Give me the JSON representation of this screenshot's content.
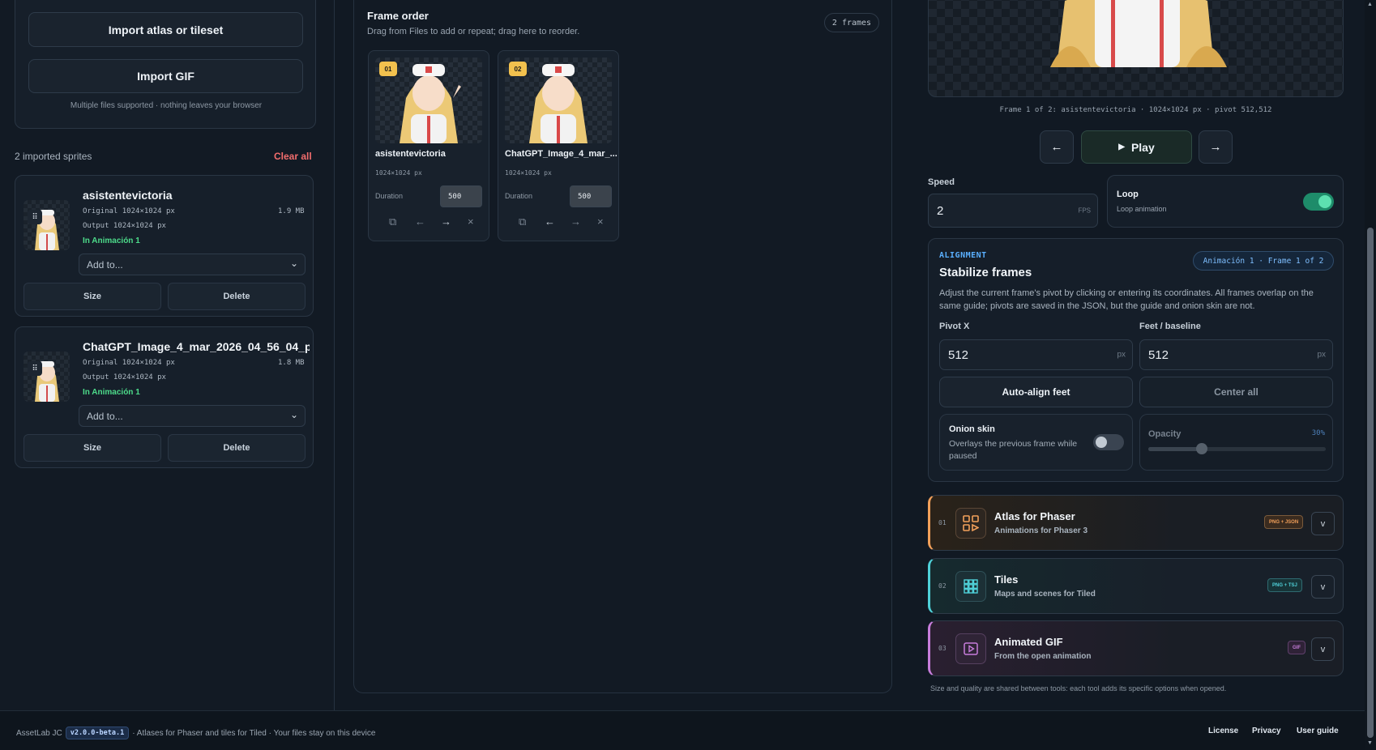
{
  "import": {
    "atlas_label": "Import atlas or tileset",
    "gif_label": "Import GIF",
    "hint": "Multiple files supported · nothing leaves your browser"
  },
  "sprites": {
    "count_label": "2 imported sprites",
    "clear_label": "Clear all",
    "items": [
      {
        "name": "asistentevictoria",
        "original": "Original 1024×1024 px",
        "output": "Output 1024×1024 px",
        "size": "1.9 MB",
        "status": "In Animación 1",
        "select": "Add to...",
        "size_btn": "Size",
        "delete_btn": "Delete"
      },
      {
        "name": "ChatGPT_Image_4_mar_2026_04_56_04_p",
        "original": "Original 1024×1024 px",
        "output": "Output 1024×1024 px",
        "size": "1.8 MB",
        "status": "In Animación 1",
        "select": "Add to...",
        "size_btn": "Size",
        "delete_btn": "Delete"
      }
    ]
  },
  "frames": {
    "title": "Frame order",
    "subtitle": "Drag from Files to add or repeat; drag here to reorder.",
    "count": "2 frames",
    "items": [
      {
        "badge": "01",
        "name": "asistentevictoria",
        "dims": "1024×1024 px",
        "duration_label": "Duration",
        "duration": "500"
      },
      {
        "badge": "02",
        "name": "ChatGPT_Image_4_mar_...",
        "dims": "1024×1024 px",
        "duration_label": "Duration",
        "duration": "500"
      }
    ]
  },
  "preview": {
    "caption": "Frame 1 of 2: asistentevictoria · 1024×1024 px · pivot 512,512",
    "prev": "←",
    "play": "Play",
    "next": "→"
  },
  "speed": {
    "label": "Speed",
    "value": "2",
    "unit": "FPS"
  },
  "loop": {
    "label": "Loop",
    "sub": "Loop animation",
    "on": true
  },
  "alignment": {
    "eyebrow": "ALIGNMENT",
    "title": "Stabilize frames",
    "chip": "Animación 1 · Frame 1 of 2",
    "desc": "Adjust the current frame's pivot by clicking or entering its coordinates. All frames overlap on the same guide; pivots are saved in the JSON, but the guide and onion skin are not.",
    "pivot_x_label": "Pivot X",
    "pivot_x": "512",
    "feet_label": "Feet / baseline",
    "feet": "512",
    "unit": "px",
    "auto_label": "Auto-align feet",
    "center_label": "Center all",
    "onion_title": "Onion skin",
    "onion_desc": "Overlays the previous frame while paused",
    "onion_on": false,
    "opacity_label": "Opacity",
    "opacity_value": "30%",
    "opacity_fraction": 0.3
  },
  "tools": [
    {
      "num": "01",
      "title": "Atlas for Phaser",
      "sub": "Animations for Phaser 3",
      "tag": "PNG + JSON",
      "color": "#f2a05a",
      "icon": "atlas-icon"
    },
    {
      "num": "02",
      "title": "Tiles",
      "sub": "Maps and scenes for Tiled",
      "tag": "PNG + TSJ",
      "color": "#4fd1d9",
      "icon": "tiles-grid-icon"
    },
    {
      "num": "03",
      "title": "Animated GIF",
      "sub": "From the open animation",
      "tag": "GIF",
      "color": "#c77ddb",
      "icon": "play-gif-icon"
    }
  ],
  "tools_note": "Size and quality are shared between tools: each tool adds its specific options when opened.",
  "footer": {
    "brand": "AssetLab JC",
    "version": "v2.0.0-beta.1",
    "tagline": "· Atlases for Phaser and tiles for Tiled · Your files stay on this device",
    "links": [
      "License",
      "Privacy",
      "User guide"
    ]
  }
}
